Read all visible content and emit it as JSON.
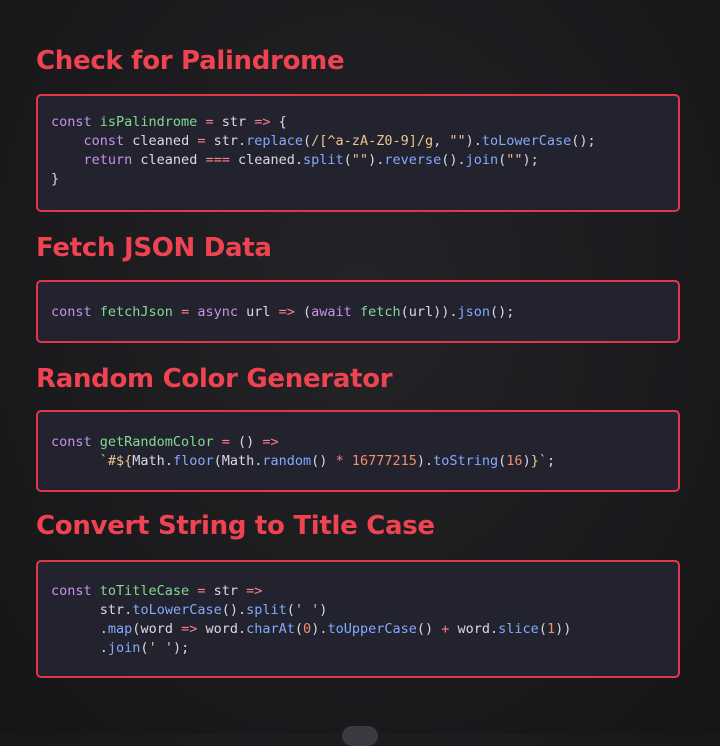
{
  "sections": [
    {
      "title": "Check for Palindrome",
      "lines": [
        [
          [
            "kw",
            "const "
          ],
          [
            "fn",
            "isPalindrome"
          ],
          [
            "op",
            " = "
          ],
          [
            "var",
            "str"
          ],
          [
            "op",
            " => "
          ],
          [
            "pun",
            "{"
          ]
        ],
        [
          [
            "pun",
            "    "
          ],
          [
            "kw",
            "const "
          ],
          [
            "var",
            "cleaned"
          ],
          [
            "op",
            " = "
          ],
          [
            "var",
            "str"
          ],
          [
            "pun",
            "."
          ],
          [
            "meth",
            "replace"
          ],
          [
            "pun",
            "("
          ],
          [
            "str",
            "/[^a-zA-Z0-9]/g"
          ],
          [
            "pun",
            ", "
          ],
          [
            "str",
            "\"\""
          ],
          [
            "pun",
            ")."
          ],
          [
            "meth",
            "toLowerCase"
          ],
          [
            "pun",
            "();"
          ]
        ],
        [
          [
            "pun",
            "    "
          ],
          [
            "kw",
            "return "
          ],
          [
            "var",
            "cleaned"
          ],
          [
            "op",
            " === "
          ],
          [
            "var",
            "cleaned"
          ],
          [
            "pun",
            "."
          ],
          [
            "meth",
            "split"
          ],
          [
            "pun",
            "("
          ],
          [
            "str",
            "\"\""
          ],
          [
            "pun",
            ")."
          ],
          [
            "meth",
            "reverse"
          ],
          [
            "pun",
            "()."
          ],
          [
            "meth",
            "join"
          ],
          [
            "pun",
            "("
          ],
          [
            "str",
            "\"\""
          ],
          [
            "pun",
            ");"
          ]
        ],
        [
          [
            "pun",
            "}"
          ]
        ]
      ]
    },
    {
      "title": "Fetch JSON Data",
      "lines": [
        [
          [
            "kw",
            "const "
          ],
          [
            "fn",
            "fetchJson"
          ],
          [
            "op",
            " = "
          ],
          [
            "kw",
            "async "
          ],
          [
            "var",
            "url"
          ],
          [
            "op",
            " => "
          ],
          [
            "pun",
            "("
          ],
          [
            "kw",
            "await "
          ],
          [
            "fn",
            "fetch"
          ],
          [
            "pun",
            "("
          ],
          [
            "var",
            "url"
          ],
          [
            "pun",
            "))."
          ],
          [
            "meth",
            "json"
          ],
          [
            "pun",
            "();"
          ]
        ]
      ]
    },
    {
      "title": "Random Color Generator",
      "lines": [
        [
          [
            "kw",
            "const "
          ],
          [
            "fn",
            "getRandomColor"
          ],
          [
            "op",
            " = "
          ],
          [
            "pun",
            "() "
          ],
          [
            "op",
            "=>"
          ]
        ],
        [
          [
            "pun",
            "      "
          ],
          [
            "str",
            "`#${"
          ],
          [
            "var",
            "Math"
          ],
          [
            "pun",
            "."
          ],
          [
            "meth",
            "floor"
          ],
          [
            "pun",
            "("
          ],
          [
            "var",
            "Math"
          ],
          [
            "pun",
            "."
          ],
          [
            "meth",
            "random"
          ],
          [
            "pun",
            "() "
          ],
          [
            "op",
            "*"
          ],
          [
            "num",
            " 16777215"
          ],
          [
            "pun",
            ")."
          ],
          [
            "meth",
            "toString"
          ],
          [
            "pun",
            "("
          ],
          [
            "num",
            "16"
          ],
          [
            "pun",
            ")"
          ],
          [
            "str",
            "}`"
          ],
          [
            "pun",
            ";"
          ]
        ]
      ]
    },
    {
      "title": "Convert String to Title Case",
      "lines": [
        [
          [
            "kw",
            "const "
          ],
          [
            "fn",
            "toTitleCase"
          ],
          [
            "op",
            " = "
          ],
          [
            "var",
            "str"
          ],
          [
            "op",
            " =>"
          ]
        ],
        [
          [
            "pun",
            "      "
          ],
          [
            "var",
            "str"
          ],
          [
            "pun",
            "."
          ],
          [
            "meth",
            "toLowerCase"
          ],
          [
            "pun",
            "()."
          ],
          [
            "meth",
            "split"
          ],
          [
            "pun",
            "("
          ],
          [
            "str",
            "' '"
          ],
          [
            "pun",
            ")"
          ]
        ],
        [
          [
            "pun",
            "      ."
          ],
          [
            "meth",
            "map"
          ],
          [
            "pun",
            "("
          ],
          [
            "var",
            "word"
          ],
          [
            "op",
            " => "
          ],
          [
            "var",
            "word"
          ],
          [
            "pun",
            "."
          ],
          [
            "meth",
            "charAt"
          ],
          [
            "pun",
            "("
          ],
          [
            "num",
            "0"
          ],
          [
            "pun",
            ")."
          ],
          [
            "meth",
            "toUpperCase"
          ],
          [
            "pun",
            "() "
          ],
          [
            "op",
            "+"
          ],
          [
            "var",
            " word"
          ],
          [
            "pun",
            "."
          ],
          [
            "meth",
            "slice"
          ],
          [
            "pun",
            "("
          ],
          [
            "num",
            "1"
          ],
          [
            "pun",
            "))"
          ]
        ],
        [
          [
            "pun",
            "      ."
          ],
          [
            "meth",
            "join"
          ],
          [
            "pun",
            "("
          ],
          [
            "str",
            "' '"
          ],
          [
            "pun",
            ");"
          ]
        ]
      ]
    }
  ],
  "colors": {
    "title": "#ef4352",
    "border": "#e0384a",
    "card_bg": "#23232f",
    "keyword": "#c792ea",
    "function": "#82d98c",
    "operator": "#ff7f8f",
    "string": "#ecc48d",
    "number": "#f78c6c",
    "method": "#82aaff"
  }
}
